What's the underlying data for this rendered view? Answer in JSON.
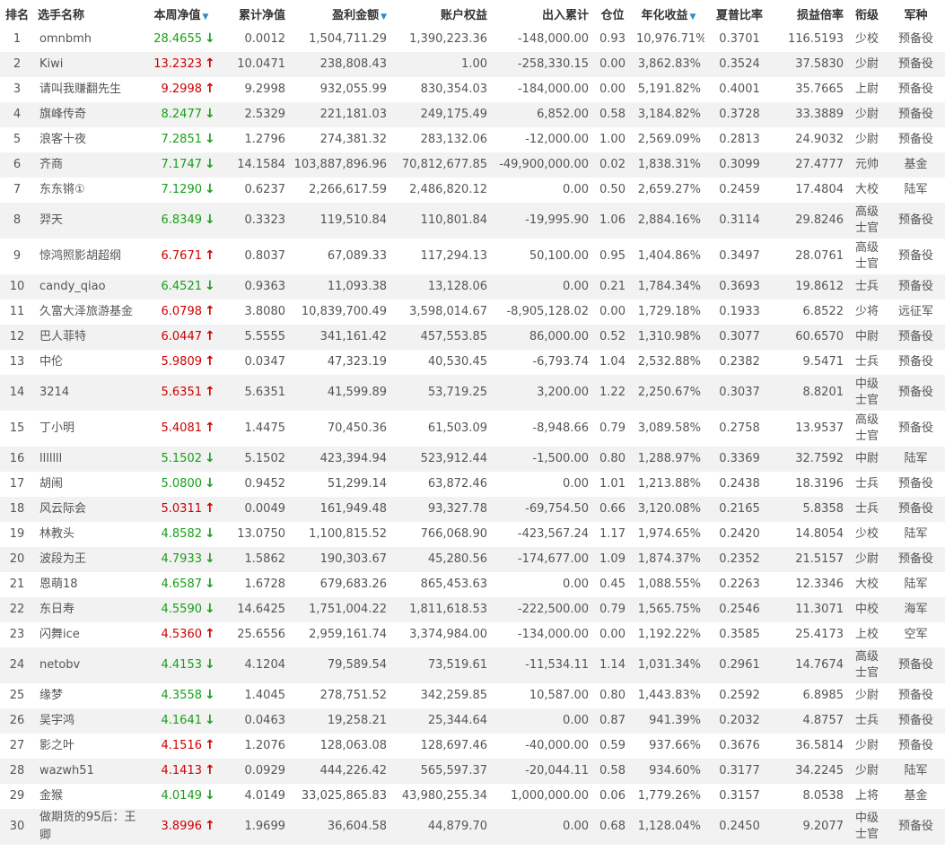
{
  "columns": [
    {
      "key": "rank",
      "label": "排名"
    },
    {
      "key": "name",
      "label": "选手名称"
    },
    {
      "key": "week_nav",
      "label": "本周净值",
      "sorted": true
    },
    {
      "key": "total_nav",
      "label": "累计净值"
    },
    {
      "key": "profit",
      "label": "盈利金额",
      "sorted": true
    },
    {
      "key": "equity",
      "label": "账户权益"
    },
    {
      "key": "inout",
      "label": "出入累计"
    },
    {
      "key": "position",
      "label": "仓位"
    },
    {
      "key": "annual",
      "label": "年化收益",
      "sorted": true
    },
    {
      "key": "sharpe",
      "label": "夏普比率"
    },
    {
      "key": "pl_ratio",
      "label": "损益倍率"
    },
    {
      "key": "title",
      "label": "衔级"
    },
    {
      "key": "army",
      "label": "军种"
    }
  ],
  "arrow_up_icon": "↑",
  "arrow_down_icon": "↓",
  "sort_icon": "▼",
  "colors": {
    "up": "#d00000",
    "down": "#18a018",
    "row_alt": "#f2f2f2",
    "sort": "#2a8ccb"
  },
  "rows": [
    {
      "rank": "1",
      "name": "omnbmh",
      "week_nav": "28.4655",
      "dir": "down",
      "total_nav": "0.0012",
      "profit": "1,504,711.29",
      "equity": "1,390,223.36",
      "inout": "-148,000.00",
      "position": "0.93",
      "annual": "10,976.71%",
      "sharpe": "0.3701",
      "pl_ratio": "116.5193",
      "title": "少校",
      "army": "预备役"
    },
    {
      "rank": "2",
      "name": "Kiwi",
      "week_nav": "13.2323",
      "dir": "up",
      "total_nav": "10.0471",
      "profit": "238,808.43",
      "equity": "1.00",
      "inout": "-258,330.15",
      "position": "0.00",
      "annual": "3,862.83%",
      "sharpe": "0.3524",
      "pl_ratio": "37.5830",
      "title": "少尉",
      "army": "预备役"
    },
    {
      "rank": "3",
      "name": "请叫我赚翻先生",
      "week_nav": "9.2998",
      "dir": "up",
      "total_nav": "9.2998",
      "profit": "932,055.99",
      "equity": "830,354.03",
      "inout": "-184,000.00",
      "position": "0.00",
      "annual": "5,191.82%",
      "sharpe": "0.4001",
      "pl_ratio": "35.7665",
      "title": "上尉",
      "army": "预备役"
    },
    {
      "rank": "4",
      "name": "旗峰传奇",
      "week_nav": "8.2477",
      "dir": "down",
      "total_nav": "2.5329",
      "profit": "221,181.03",
      "equity": "249,175.49",
      "inout": "6,852.00",
      "position": "0.58",
      "annual": "3,184.82%",
      "sharpe": "0.3728",
      "pl_ratio": "33.3889",
      "title": "少尉",
      "army": "预备役"
    },
    {
      "rank": "5",
      "name": "浪客十夜",
      "week_nav": "7.2851",
      "dir": "down",
      "total_nav": "1.2796",
      "profit": "274,381.32",
      "equity": "283,132.06",
      "inout": "-12,000.00",
      "position": "1.00",
      "annual": "2,569.09%",
      "sharpe": "0.2813",
      "pl_ratio": "24.9032",
      "title": "少尉",
      "army": "预备役"
    },
    {
      "rank": "6",
      "name": "齐商",
      "week_nav": "7.1747",
      "dir": "down",
      "total_nav": "14.1584",
      "profit": "103,887,896.96",
      "equity": "70,812,677.85",
      "inout": "-49,900,000.00",
      "position": "0.02",
      "annual": "1,838.31%",
      "sharpe": "0.3099",
      "pl_ratio": "27.4777",
      "title": "元帅",
      "army": "基金"
    },
    {
      "rank": "7",
      "name": "东东锵①",
      "week_nav": "7.1290",
      "dir": "down",
      "total_nav": "0.6237",
      "profit": "2,266,617.59",
      "equity": "2,486,820.12",
      "inout": "0.00",
      "position": "0.50",
      "annual": "2,659.27%",
      "sharpe": "0.2459",
      "pl_ratio": "17.4804",
      "title": "大校",
      "army": "陆军"
    },
    {
      "rank": "8",
      "name": "羿天",
      "week_nav": "6.8349",
      "dir": "down",
      "total_nav": "0.3323",
      "profit": "119,510.84",
      "equity": "110,801.84",
      "inout": "-19,995.90",
      "position": "1.06",
      "annual": "2,884.16%",
      "sharpe": "0.3114",
      "pl_ratio": "29.8246",
      "title": "高级士官",
      "army": "预备役",
      "tall": true
    },
    {
      "rank": "9",
      "name": "惊鸿照影胡超纲",
      "week_nav": "6.7671",
      "dir": "up",
      "total_nav": "0.8037",
      "profit": "67,089.33",
      "equity": "117,294.13",
      "inout": "50,100.00",
      "position": "0.95",
      "annual": "1,404.86%",
      "sharpe": "0.3497",
      "pl_ratio": "28.0761",
      "title": "高级士官",
      "army": "预备役",
      "tall": true
    },
    {
      "rank": "10",
      "name": "candy_qiao",
      "week_nav": "6.4521",
      "dir": "down",
      "total_nav": "0.9363",
      "profit": "11,093.38",
      "equity": "13,128.06",
      "inout": "0.00",
      "position": "0.21",
      "annual": "1,784.34%",
      "sharpe": "0.3693",
      "pl_ratio": "19.8612",
      "title": "士兵",
      "army": "预备役"
    },
    {
      "rank": "11",
      "name": "久富大泽旅游基金",
      "week_nav": "6.0798",
      "dir": "up",
      "total_nav": "3.8080",
      "profit": "10,839,700.49",
      "equity": "3,598,014.67",
      "inout": "-8,905,128.02",
      "position": "0.00",
      "annual": "1,729.18%",
      "sharpe": "0.1933",
      "pl_ratio": "6.8522",
      "title": "少将",
      "army": "远征军"
    },
    {
      "rank": "12",
      "name": "巴人菲特",
      "week_nav": "6.0447",
      "dir": "up",
      "total_nav": "5.5555",
      "profit": "341,161.42",
      "equity": "457,553.85",
      "inout": "86,000.00",
      "position": "0.52",
      "annual": "1,310.98%",
      "sharpe": "0.3077",
      "pl_ratio": "60.6570",
      "title": "中尉",
      "army": "预备役"
    },
    {
      "rank": "13",
      "name": "中伦",
      "week_nav": "5.9809",
      "dir": "up",
      "total_nav": "0.0347",
      "profit": "47,323.19",
      "equity": "40,530.45",
      "inout": "-6,793.74",
      "position": "1.04",
      "annual": "2,532.88%",
      "sharpe": "0.2382",
      "pl_ratio": "9.5471",
      "title": "士兵",
      "army": "预备役"
    },
    {
      "rank": "14",
      "name": "3214",
      "week_nav": "5.6351",
      "dir": "up",
      "total_nav": "5.6351",
      "profit": "41,599.89",
      "equity": "53,719.25",
      "inout": "3,200.00",
      "position": "1.22",
      "annual": "2,250.67%",
      "sharpe": "0.3037",
      "pl_ratio": "8.8201",
      "title": "中级士官",
      "army": "预备役",
      "tall": true
    },
    {
      "rank": "15",
      "name": "丁小明",
      "week_nav": "5.4081",
      "dir": "up",
      "total_nav": "1.4475",
      "profit": "70,450.36",
      "equity": "61,503.09",
      "inout": "-8,948.66",
      "position": "0.79",
      "annual": "3,089.58%",
      "sharpe": "0.2758",
      "pl_ratio": "13.9537",
      "title": "高级士官",
      "army": "预备役",
      "tall": true
    },
    {
      "rank": "16",
      "name": "lllllll",
      "week_nav": "5.1502",
      "dir": "down",
      "total_nav": "5.1502",
      "profit": "423,394.94",
      "equity": "523,912.44",
      "inout": "-1,500.00",
      "position": "0.80",
      "annual": "1,288.97%",
      "sharpe": "0.3369",
      "pl_ratio": "32.7592",
      "title": "中尉",
      "army": "陆军"
    },
    {
      "rank": "17",
      "name": "胡闹",
      "week_nav": "5.0800",
      "dir": "down",
      "total_nav": "0.9452",
      "profit": "51,299.14",
      "equity": "63,872.46",
      "inout": "0.00",
      "position": "1.01",
      "annual": "1,213.88%",
      "sharpe": "0.2438",
      "pl_ratio": "18.3196",
      "title": "士兵",
      "army": "预备役"
    },
    {
      "rank": "18",
      "name": "风云际会",
      "week_nav": "5.0311",
      "dir": "up",
      "total_nav": "0.0049",
      "profit": "161,949.48",
      "equity": "93,327.78",
      "inout": "-69,754.50",
      "position": "0.66",
      "annual": "3,120.08%",
      "sharpe": "0.2165",
      "pl_ratio": "5.8358",
      "title": "士兵",
      "army": "预备役"
    },
    {
      "rank": "19",
      "name": "林教头",
      "week_nav": "4.8582",
      "dir": "down",
      "total_nav": "13.0750",
      "profit": "1,100,815.52",
      "equity": "766,068.90",
      "inout": "-423,567.24",
      "position": "1.17",
      "annual": "1,974.65%",
      "sharpe": "0.2420",
      "pl_ratio": "14.8054",
      "title": "少校",
      "army": "陆军"
    },
    {
      "rank": "20",
      "name": "波段为王",
      "week_nav": "4.7933",
      "dir": "down",
      "total_nav": "1.5862",
      "profit": "190,303.67",
      "equity": "45,280.56",
      "inout": "-174,677.00",
      "position": "1.09",
      "annual": "1,874.37%",
      "sharpe": "0.2352",
      "pl_ratio": "21.5157",
      "title": "少尉",
      "army": "预备役"
    },
    {
      "rank": "21",
      "name": "恩萌18",
      "week_nav": "4.6587",
      "dir": "down",
      "total_nav": "1.6728",
      "profit": "679,683.26",
      "equity": "865,453.63",
      "inout": "0.00",
      "position": "0.45",
      "annual": "1,088.55%",
      "sharpe": "0.2263",
      "pl_ratio": "12.3346",
      "title": "大校",
      "army": "陆军"
    },
    {
      "rank": "22",
      "name": "东日寿",
      "week_nav": "4.5590",
      "dir": "down",
      "total_nav": "14.6425",
      "profit": "1,751,004.22",
      "equity": "1,811,618.53",
      "inout": "-222,500.00",
      "position": "0.79",
      "annual": "1,565.75%",
      "sharpe": "0.2546",
      "pl_ratio": "11.3071",
      "title": "中校",
      "army": "海军"
    },
    {
      "rank": "23",
      "name": "闪舞ice",
      "week_nav": "4.5360",
      "dir": "up",
      "total_nav": "25.6556",
      "profit": "2,959,161.74",
      "equity": "3,374,984.00",
      "inout": "-134,000.00",
      "position": "0.00",
      "annual": "1,192.22%",
      "sharpe": "0.3585",
      "pl_ratio": "25.4173",
      "title": "上校",
      "army": "空军"
    },
    {
      "rank": "24",
      "name": "netobv",
      "week_nav": "4.4153",
      "dir": "down",
      "total_nav": "4.1204",
      "profit": "79,589.54",
      "equity": "73,519.61",
      "inout": "-11,534.11",
      "position": "1.14",
      "annual": "1,031.34%",
      "sharpe": "0.2961",
      "pl_ratio": "14.7674",
      "title": "高级士官",
      "army": "预备役",
      "tall": true
    },
    {
      "rank": "25",
      "name": "缘梦",
      "week_nav": "4.3558",
      "dir": "down",
      "total_nav": "1.4045",
      "profit": "278,751.52",
      "equity": "342,259.85",
      "inout": "10,587.00",
      "position": "0.80",
      "annual": "1,443.83%",
      "sharpe": "0.2592",
      "pl_ratio": "6.8985",
      "title": "少尉",
      "army": "预备役"
    },
    {
      "rank": "26",
      "name": "吴宇鸿",
      "week_nav": "4.1641",
      "dir": "down",
      "total_nav": "0.0463",
      "profit": "19,258.21",
      "equity": "25,344.64",
      "inout": "0.00",
      "position": "0.87",
      "annual": "941.39%",
      "sharpe": "0.2032",
      "pl_ratio": "4.8757",
      "title": "士兵",
      "army": "预备役"
    },
    {
      "rank": "27",
      "name": "影之叶",
      "week_nav": "4.1516",
      "dir": "up",
      "total_nav": "1.2076",
      "profit": "128,063.08",
      "equity": "128,697.46",
      "inout": "-40,000.00",
      "position": "0.59",
      "annual": "937.66%",
      "sharpe": "0.3676",
      "pl_ratio": "36.5814",
      "title": "少尉",
      "army": "预备役"
    },
    {
      "rank": "28",
      "name": "wazwh51",
      "week_nav": "4.1413",
      "dir": "up",
      "total_nav": "0.0929",
      "profit": "444,226.42",
      "equity": "565,597.37",
      "inout": "-20,044.11",
      "position": "0.58",
      "annual": "934.60%",
      "sharpe": "0.3177",
      "pl_ratio": "34.2245",
      "title": "少尉",
      "army": "陆军"
    },
    {
      "rank": "29",
      "name": "金猴",
      "week_nav": "4.0149",
      "dir": "down",
      "total_nav": "4.0149",
      "profit": "33,025,865.83",
      "equity": "43,980,255.34",
      "inout": "1,000,000.00",
      "position": "0.06",
      "annual": "1,779.26%",
      "sharpe": "0.3157",
      "pl_ratio": "8.0538",
      "title": "上将",
      "army": "基金"
    },
    {
      "rank": "30",
      "name": "做期货的95后：王卿",
      "week_nav": "3.8996",
      "dir": "up",
      "total_nav": "1.9699",
      "profit": "36,604.58",
      "equity": "44,879.70",
      "inout": "0.00",
      "position": "0.68",
      "annual": "1,128.04%",
      "sharpe": "0.2450",
      "pl_ratio": "9.2077",
      "title": "中级士官",
      "army": "预备役",
      "tall": true
    }
  ]
}
